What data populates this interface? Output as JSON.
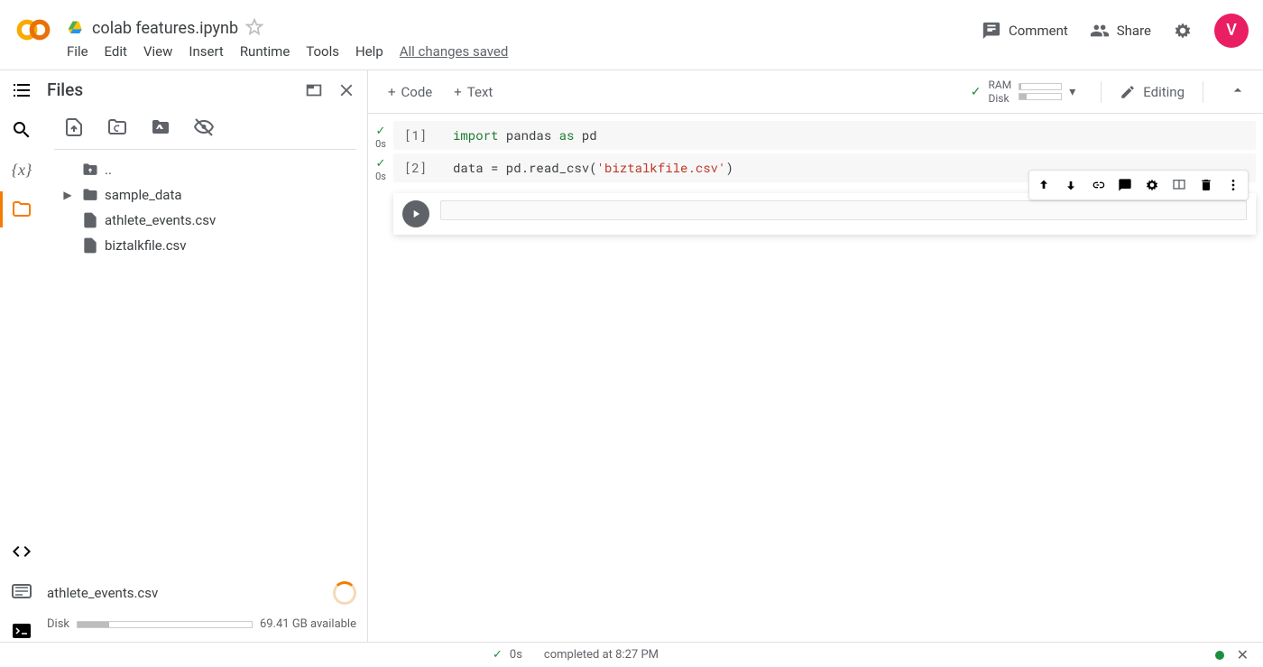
{
  "header": {
    "doc_title": "colab features.ipynb",
    "menu": {
      "file": "File",
      "edit": "Edit",
      "view": "View",
      "insert": "Insert",
      "runtime": "Runtime",
      "tools": "Tools",
      "help": "Help",
      "save_status": "All changes saved"
    },
    "comment": "Comment",
    "share": "Share",
    "avatar_letter": "V"
  },
  "sidebar": {
    "title": "Files",
    "tree": {
      "parent": "..",
      "folder": "sample_data",
      "file1": "athlete_events.csv",
      "file2": "biztalkfile.csv"
    },
    "uploading": "athlete_events.csv",
    "disk_label": "Disk",
    "disk_available": "69.41 GB available",
    "disk_pct": 18
  },
  "toolbar": {
    "code": "Code",
    "text": "Text",
    "ram_label": "RAM",
    "disk_label": "Disk",
    "ram_pct": 4,
    "disk_pct": 18,
    "editing": "Editing"
  },
  "cells": [
    {
      "prompt": "[1]",
      "time": "0s",
      "tokens": [
        {
          "t": "import ",
          "c": "tk-kw"
        },
        {
          "t": "pandas ",
          "c": ""
        },
        {
          "t": "as ",
          "c": "tk-kw"
        },
        {
          "t": "pd",
          "c": ""
        }
      ]
    },
    {
      "prompt": "[2]",
      "time": "0s",
      "tokens": [
        {
          "t": "data = pd.read_csv(",
          "c": ""
        },
        {
          "t": "'biztalkfile.csv'",
          "c": "tk-str"
        },
        {
          "t": ")",
          "c": ""
        }
      ]
    }
  ],
  "statusbar": {
    "duration": "0s",
    "message": "completed at 8:27 PM"
  }
}
